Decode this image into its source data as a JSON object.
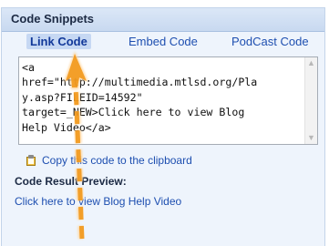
{
  "panel": {
    "title": "Code Snippets"
  },
  "tabs": [
    {
      "label": "Link Code",
      "active": true
    },
    {
      "label": "Embed Code",
      "active": false
    },
    {
      "label": "PodCast Code",
      "active": false
    }
  ],
  "code_box": {
    "lines": [
      "<a",
      "href=\"http://multimedia.mtlsd.org/Pla",
      "y.asp?FILEID=14592\"",
      "target=_NEW>Click here to view Blog",
      "Help Video</a>"
    ]
  },
  "copy_link": {
    "label": "Copy this code to the clipboard",
    "icon": "clipboard-icon"
  },
  "result": {
    "heading": "Code Result Preview:",
    "link_label": "Click here to view Blog Help Video"
  },
  "annotation": {
    "icon": "orange-arrow-icon",
    "color": "#f39a1e"
  },
  "colors": {
    "link": "#1e4fb0",
    "panel_bg": "#eef4fc",
    "header_bg": "#c8d9f0"
  }
}
